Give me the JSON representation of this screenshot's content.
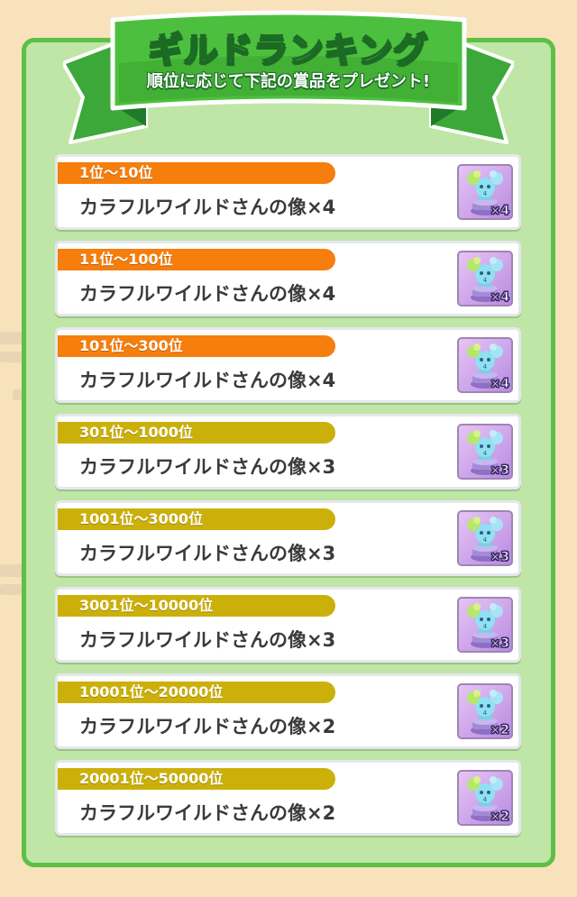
{
  "banner": {
    "title": "ギルドランキング",
    "subtitle": "順位に応じて下記の賞品をプレゼント!"
  },
  "colors": {
    "background": "#f7e2bb",
    "panel": "#bfe6a6",
    "panel_border": "#5dbf47",
    "rank_orange": "#f57e0c",
    "rank_gold": "#ccb00a"
  },
  "rewards": [
    {
      "rank": "1位〜10位",
      "prize": "カラフルワイルドさんの像×4",
      "qty": "×4",
      "tier": "orange"
    },
    {
      "rank": "11位〜100位",
      "prize": "カラフルワイルドさんの像×4",
      "qty": "×4",
      "tier": "orange"
    },
    {
      "rank": "101位〜300位",
      "prize": "カラフルワイルドさんの像×4",
      "qty": "×4",
      "tier": "orange"
    },
    {
      "rank": "301位〜1000位",
      "prize": "カラフルワイルドさんの像×3",
      "qty": "×3",
      "tier": "gold"
    },
    {
      "rank": "1001位〜3000位",
      "prize": "カラフルワイルドさんの像×3",
      "qty": "×3",
      "tier": "gold"
    },
    {
      "rank": "3001位〜10000位",
      "prize": "カラフルワイルドさんの像×3",
      "qty": "×3",
      "tier": "gold"
    },
    {
      "rank": "10001位〜20000位",
      "prize": "カラフルワイルドさんの像×2",
      "qty": "×2",
      "tier": "gold"
    },
    {
      "rank": "20001位〜50000位",
      "prize": "カラフルワイルドさんの像×2",
      "qty": "×2",
      "tier": "gold"
    }
  ],
  "reward_icon": "statue-icon"
}
